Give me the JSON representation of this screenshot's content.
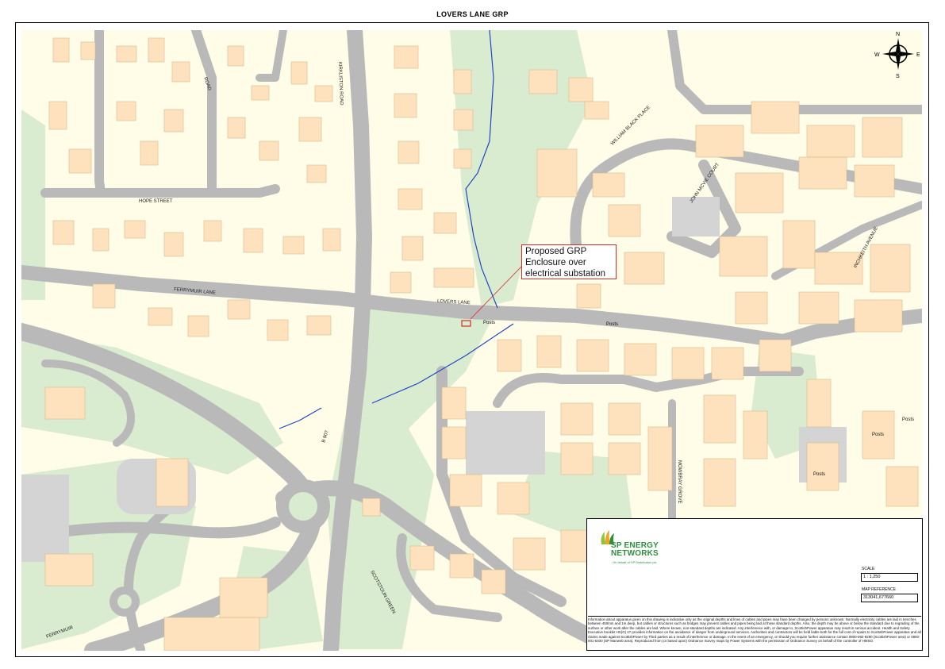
{
  "title": "LOVERS LANE GRP",
  "callout": {
    "line1": "Proposed GRP",
    "line2": "Enclosure over",
    "line3": "electrical substation"
  },
  "compass": {
    "n": "N",
    "e": "E",
    "s": "S",
    "w": "W"
  },
  "roads": {
    "hope_street": "HOPE STREET",
    "ferrymuir_lane": "FERRYMUIR LANE",
    "lovers_lane": "LOVERS LANE",
    "road": "ROAD",
    "kirkliston_road": "KIRKLISTON ROAD",
    "william_black_place": "WILLIAM BLACK PLACE",
    "john_mcvie_court": "JOHN MCVIE COURT",
    "inchkeith_avenue": "INCHKEITH AVENUE",
    "mowbray_grove": "MOWBRAY GROVE",
    "scotstoun_green": "SCOTSTOUN GREEN",
    "ferrymuir": "FERRYMUIR",
    "b907": "B 907"
  },
  "posts_label": "Posts",
  "panel": {
    "logo_line1": "SP ENERGY",
    "logo_line2": "NETWORKS",
    "logo_sub": "On behalf of SP Distribution plc",
    "scale_label": "SCALE",
    "scale_value": "1 : 1,250",
    "ref_label": "MAP REFERENCE",
    "ref_value": "313041,677660",
    "disclaimer": "Information about apparatus given on this drawing is indicative only as the original depths and lines of cables and pipes may have been changed by persons unknown. Normally electricity cables are laid in trenches between 450mm and 1m deep, but cables or structures such as bridges may prevent cables and pipes being laid at these standard depths. Also, the depth may be above or below the standard due to regrading of the surface or other work after the cables are laid. Where known, non-standard depths are indicated. Any interference with, or damage to, ScottishPower apparatus may result in serious accident. Health and Safety Executive booklet HS(G) 47 provides information on the avoidance of danger from underground services. Authorities and contractors will be held liable both for the full cost of repairs to ScottishPower apparatus and all claims made against ScottishPower by Third parties as a result of interference or damage. In the event of an emergency, or should you require further assistance contact 0800-092-9290 (ScottishPower area) or 0800-001-5400 (SP Manweb area). Reproduced from (or based upon) Ordnance Survey maps by Power Systems with the permission of Ordnance Survey on behalf of the controller of HMSO."
  },
  "colors": {
    "background": "#fffde8",
    "building": "#fde2bd",
    "road": "#b9b9b9",
    "green": "#d9ecd0",
    "cable": "#2046c8",
    "callout_border": "#d42a2a",
    "brand": "#2d8f3c"
  }
}
